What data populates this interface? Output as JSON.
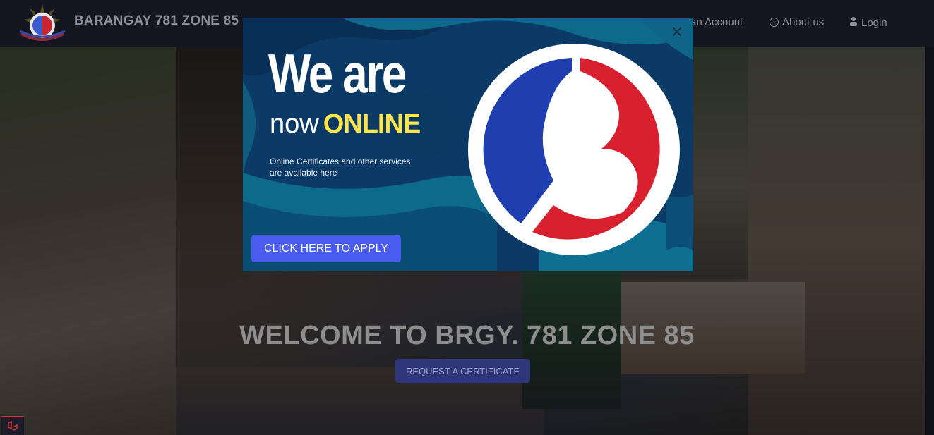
{
  "navbar": {
    "brand_name": "BARANGAY 781 ZONE 85",
    "create_account_label": "an Account",
    "about_label": "About us",
    "login_label": "Login"
  },
  "hero": {
    "welcome_text": "WELCOME TO BRGY. 781 ZONE 85",
    "request_button_label": "REQUEST A CERTIFICATE"
  },
  "modal": {
    "headline_line1": "We are",
    "headline_now": "now",
    "headline_online": "ONLINE",
    "subtext": "Online Certificates and other services are available here",
    "apply_button_label": "CLICK HERE TO APPLY",
    "close_symbol": "×"
  },
  "icons": {
    "info": "info-icon",
    "login": "user-icon",
    "close": "close-icon",
    "logo": "barangay-b-logo"
  },
  "colors": {
    "modal_bg": "#0c3a66",
    "apply_button": "#4a5cf0",
    "highlight_yellow": "#ffe44a",
    "logo_red": "#d8202f",
    "logo_blue": "#1f3fb0",
    "request_button": "#2e3578"
  }
}
